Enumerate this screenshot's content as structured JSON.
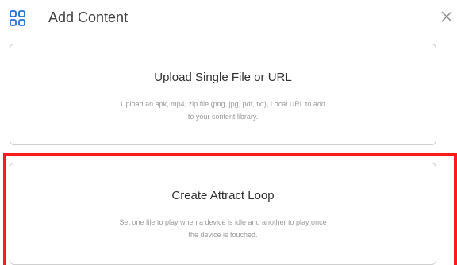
{
  "header": {
    "icon": "grid-icon",
    "title": "Add Content",
    "close_icon": "close-icon"
  },
  "options": [
    {
      "title": "Upload Single File or URL",
      "description_line1": "Upload an apk, mp4, zip file (png, jpg, pdf, txt), Local URL to add",
      "description_line2": "to your content library."
    },
    {
      "title": "Create Attract Loop",
      "description_line1": "Set one file to play when a device is idle and another to play once",
      "description_line2": "the device is touched."
    }
  ],
  "colors": {
    "accent": "#1e6fd9",
    "highlight": "#ff1a1a",
    "card_border": "#cfcfcf",
    "text_muted": "#9a9a9a"
  }
}
